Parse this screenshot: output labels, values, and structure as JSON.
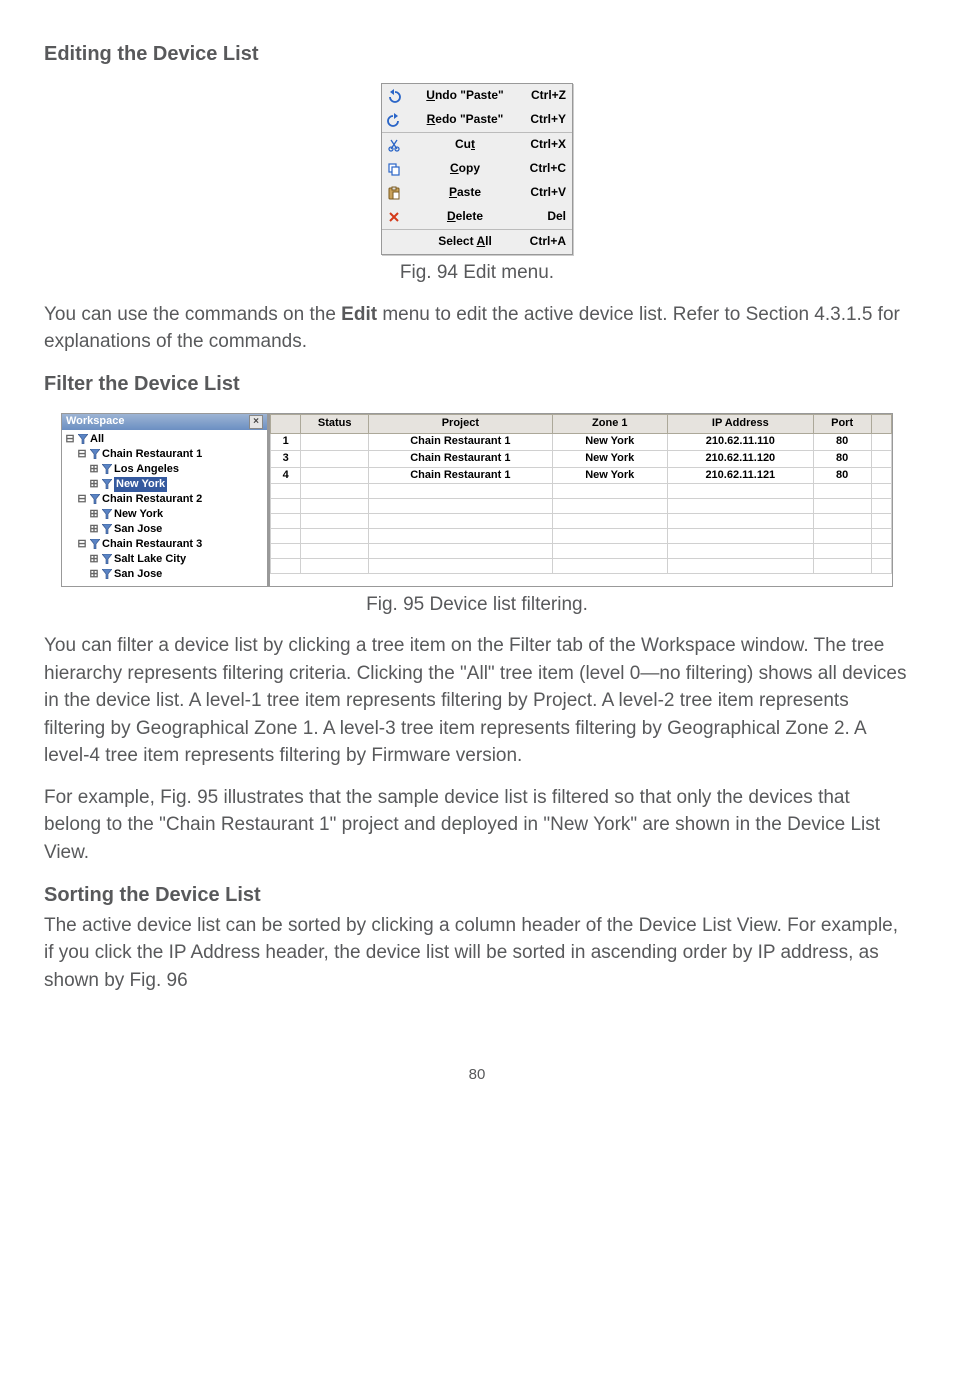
{
  "headings": {
    "editing": "Editing the Device List",
    "filter": "Filter the Device List",
    "sorting": "Sorting the Device List"
  },
  "edit_menu": {
    "items": [
      {
        "label_pre": "",
        "label_u": "U",
        "label_post": "ndo \"Paste\"",
        "shortcut": "Ctrl+Z",
        "icon": "undo"
      },
      {
        "label_pre": "",
        "label_u": "R",
        "label_post": "edo \"Paste\"",
        "shortcut": "Ctrl+Y",
        "icon": "redo"
      },
      "sep",
      {
        "label_pre": "Cu",
        "label_u": "t",
        "label_post": "",
        "shortcut": "Ctrl+X",
        "icon": "cut"
      },
      {
        "label_pre": "",
        "label_u": "C",
        "label_post": "opy",
        "shortcut": "Ctrl+C",
        "icon": "copy"
      },
      {
        "label_pre": "",
        "label_u": "P",
        "label_post": "aste",
        "shortcut": "Ctrl+V",
        "icon": "paste"
      },
      {
        "label_pre": "",
        "label_u": "D",
        "label_post": "elete",
        "shortcut": "Del",
        "icon": "delete"
      },
      "sep",
      {
        "label_pre": "Select ",
        "label_u": "A",
        "label_post": "ll",
        "shortcut": "Ctrl+A",
        "icon": ""
      }
    ],
    "caption": "Fig. 94 Edit menu."
  },
  "para1_a": "You can use the commands on the ",
  "para1_b": "Edit",
  "para1_c": " menu to edit the active device list. Refer to Section 4.3.1.5 for explanations of the commands.",
  "workspace": {
    "title": "Workspace",
    "tree": {
      "all": "All",
      "cr1": "Chain Restaurant 1",
      "la": "Los Angeles",
      "ny": "New York",
      "cr2": "Chain Restaurant 2",
      "ny2": "New York",
      "sj": "San Jose",
      "cr3": "Chain Restaurant 3",
      "slc": "Salt Lake City",
      "sj2": "San Jose"
    }
  },
  "device_table": {
    "headers": {
      "idx": "",
      "status": "Status",
      "project": "Project",
      "zone1": "Zone 1",
      "ip": "IP Address",
      "port": "Port"
    },
    "rows": [
      {
        "idx": "1",
        "status": "",
        "project": "Chain Restaurant 1",
        "zone1": "New York",
        "ip": "210.62.11.110",
        "port": "80"
      },
      {
        "idx": "3",
        "status": "",
        "project": "Chain Restaurant 1",
        "zone1": "New York",
        "ip": "210.62.11.120",
        "port": "80"
      },
      {
        "idx": "4",
        "status": "",
        "project": "Chain Restaurant 1",
        "zone1": "New York",
        "ip": "210.62.11.121",
        "port": "80"
      }
    ],
    "caption": "Fig. 95 Device list filtering."
  },
  "para_filter": "You can filter a device list by clicking a tree item on the Filter tab of the Workspace window. The tree hierarchy represents filtering criteria. Clicking the \"All\" tree item (level 0—no filtering) shows all devices in the device list. A level-1 tree item represents filtering by Project. A level-2 tree item represents filtering by Geographical Zone 1. A level-3 tree item represents filtering by Geographical Zone 2. A level-4 tree item represents filtering by Firmware version.",
  "para_example": "For example, Fig. 95 illustrates that the sample device list is filtered so that only the devices that belong to the \"Chain Restaurant 1\" project and deployed in \"New York\" are shown in the Device List View.",
  "para_sort": "The active device list can be sorted by clicking a column header of the Device List View. For example, if you click the IP Address header, the device list will be sorted in ascending order by IP address, as shown by Fig. 96",
  "page_number": "80"
}
